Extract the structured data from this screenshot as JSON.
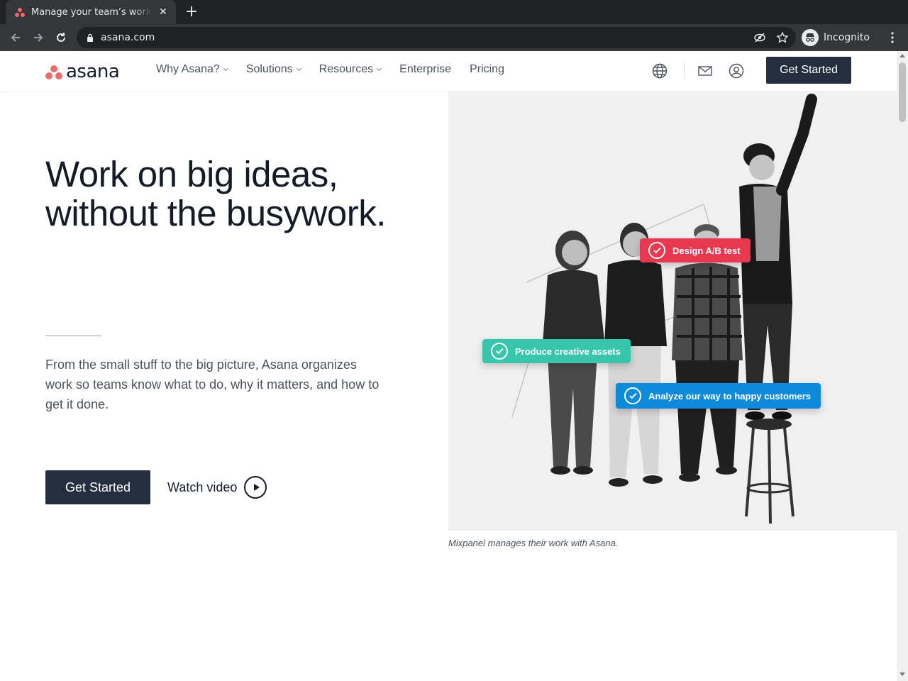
{
  "browser": {
    "tab_title": "Manage your team’s work, projects, & tasks online · Asana",
    "url": "asana.com",
    "profile_label": "Incognito"
  },
  "header": {
    "logo_text": "asana",
    "nav": [
      {
        "label": "Why Asana?",
        "has_dropdown": true
      },
      {
        "label": "Solutions",
        "has_dropdown": true
      },
      {
        "label": "Resources",
        "has_dropdown": true
      },
      {
        "label": "Enterprise",
        "has_dropdown": false
      },
      {
        "label": "Pricing",
        "has_dropdown": false
      }
    ],
    "cta_label": "Get Started"
  },
  "hero": {
    "title": "Work on big ideas, without the busywork.",
    "description": "From the small stuff to the big picture, Asana organizes work so teams know what to do, why it matters, and how to get it done.",
    "primary_cta": "Get Started",
    "secondary_cta": "Watch video",
    "image_caption": "Mixpanel manages their work with Asana.",
    "task_chips": [
      {
        "label": "Design A/B test",
        "color": "#e8384f"
      },
      {
        "label": "Produce creative assets",
        "color": "#37c5ab"
      },
      {
        "label": "Analyze our way to happy customers",
        "color": "#0d8bda"
      }
    ]
  },
  "colors": {
    "brand_coral": "#f06a6a",
    "dark_button": "#232f3e",
    "text_primary": "#151b26"
  }
}
